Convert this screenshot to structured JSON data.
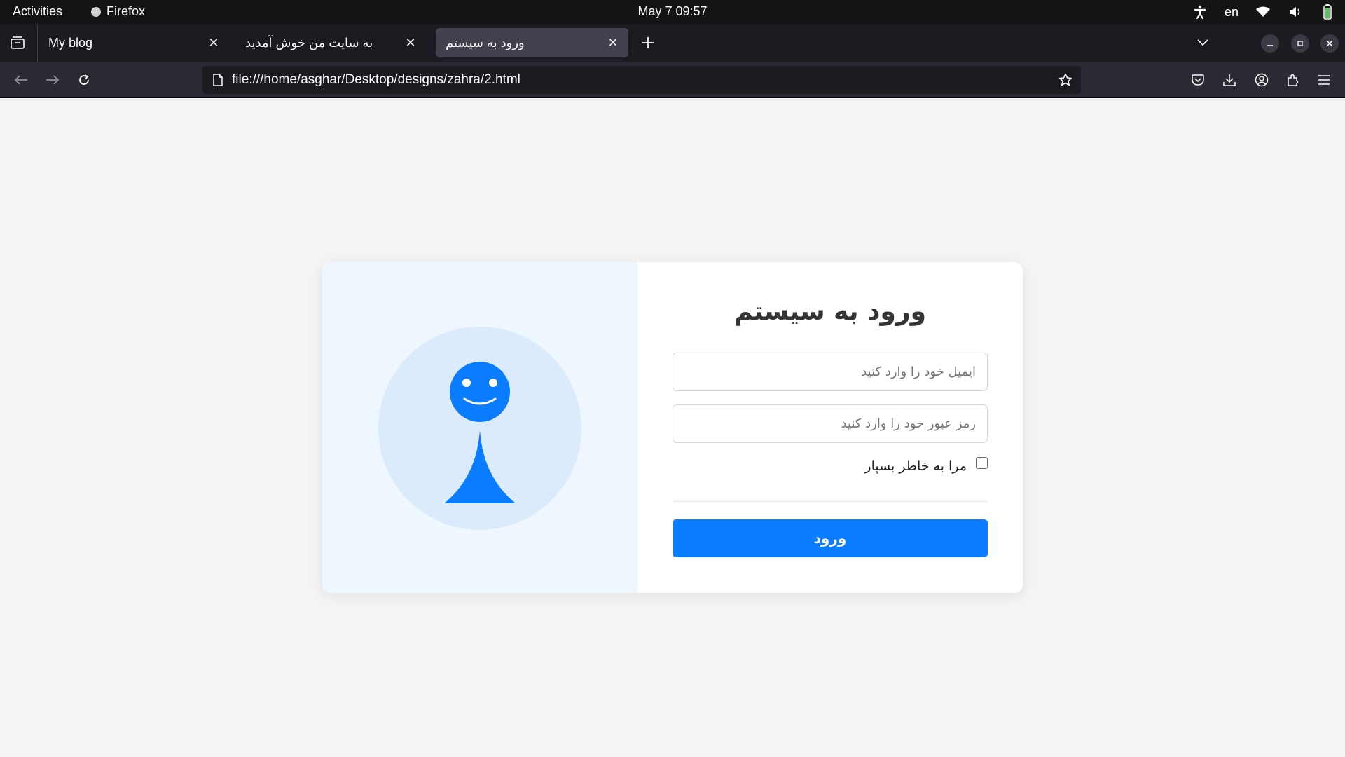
{
  "system_bar": {
    "activities": "Activities",
    "app_name": "Firefox",
    "clock": "May 7  09:57",
    "language": "en"
  },
  "tabs": [
    {
      "label": "My blog",
      "active": false
    },
    {
      "label": "به سایت من خوش آمدید",
      "active": false
    },
    {
      "label": "ورود به سیستم",
      "active": true
    }
  ],
  "toolbar": {
    "url": "file:///home/asghar/Desktop/designs/zahra/2.html"
  },
  "login": {
    "title": "ورود به سیستم",
    "email_placeholder": "ایمیل خود را وارد کنید",
    "password_placeholder": "رمز عبور خود را وارد کنید",
    "remember_label": "مرا به خاطر بسپار",
    "remember_checked": false,
    "submit_label": "ورود"
  },
  "colors": {
    "accent": "#0a7cff",
    "illustration_bg": "#eef6fe",
    "illustration_circle": "#dcebfc"
  },
  "icons": [
    "tab-overview-icon",
    "close-icon",
    "new-tab-icon",
    "tab-list-icon",
    "minimize-icon",
    "maximize-icon",
    "back-icon",
    "forward-icon",
    "reload-icon",
    "page-icon",
    "bookmark-star-icon",
    "pocket-icon",
    "download-icon",
    "account-icon",
    "extensions-icon",
    "menu-icon",
    "accessibility-icon",
    "wifi-icon",
    "volume-icon",
    "battery-icon"
  ]
}
